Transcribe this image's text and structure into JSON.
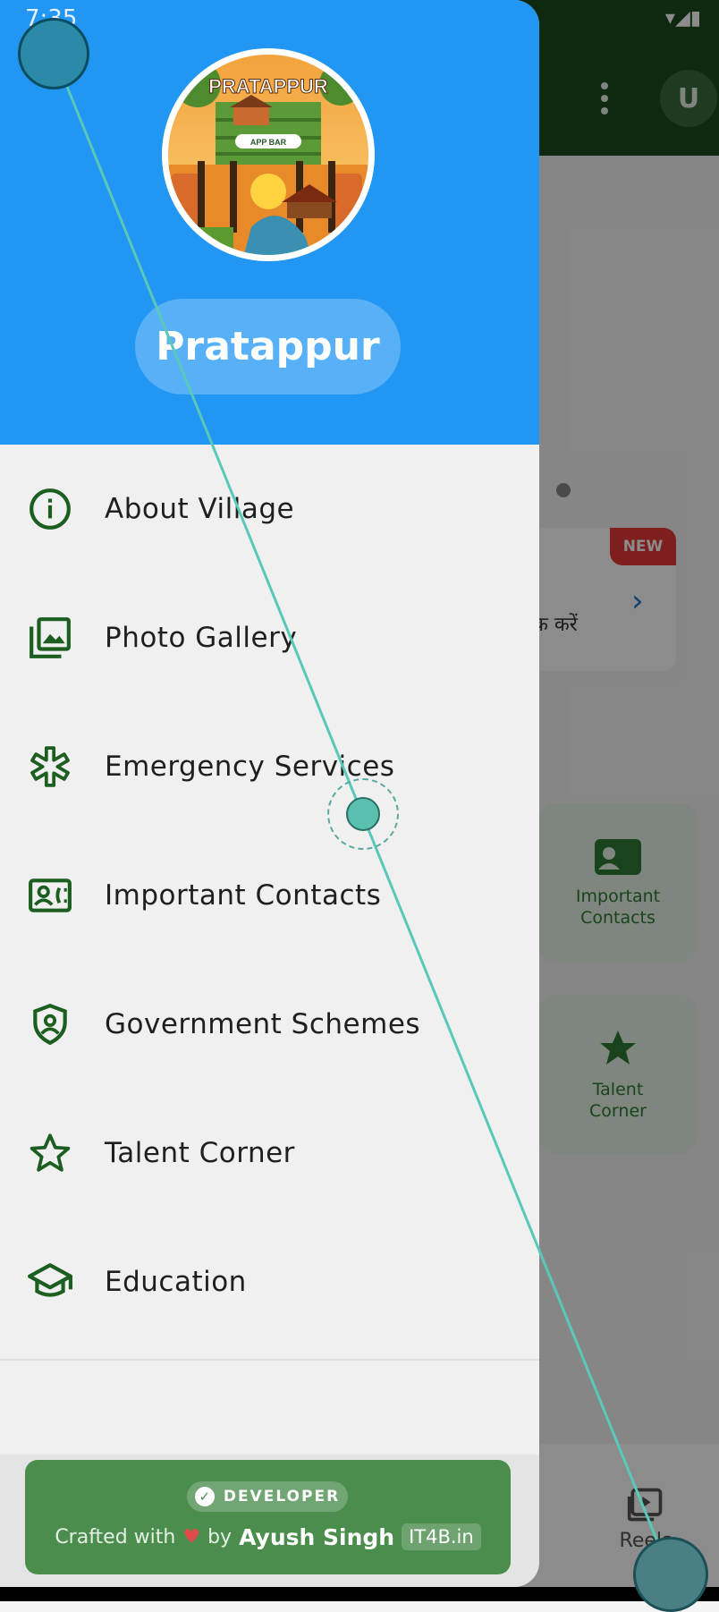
{
  "status_bar": {
    "time": "7:35"
  },
  "background": {
    "avatar_initial": "U",
    "new_badge": "NEW",
    "card_text": "क करें",
    "tile_important_contacts": "Important Contacts",
    "tile_talent_corner": "Talent Corner",
    "bottom_nav_reels": "Reels"
  },
  "drawer": {
    "logo_text": "PRATAPPUR",
    "logo_subtext": "APP BAR",
    "village_name": "Pratappur",
    "menu": [
      {
        "label": "About Village",
        "icon": "info-icon"
      },
      {
        "label": "Photo Gallery",
        "icon": "photo-library-icon"
      },
      {
        "label": "Emergency Services",
        "icon": "medical-asterisk-icon"
      },
      {
        "label": "Important Contacts",
        "icon": "contact-card-icon"
      },
      {
        "label": "Government Schemes",
        "icon": "shield-icon"
      },
      {
        "label": "Talent Corner",
        "icon": "star-icon"
      },
      {
        "label": "Education",
        "icon": "graduation-cap-icon"
      }
    ],
    "developer": {
      "badge": "DEVELOPER",
      "crafted_prefix": "Crafted with",
      "crafted_by": "by",
      "author": "Ayush Singh",
      "site": "IT4B.in"
    }
  },
  "colors": {
    "drawer_header": "#2196f3",
    "icon_green": "#1b5e20",
    "developer_card": "#4a8d4d",
    "app_bar": "#1c4a1e"
  }
}
